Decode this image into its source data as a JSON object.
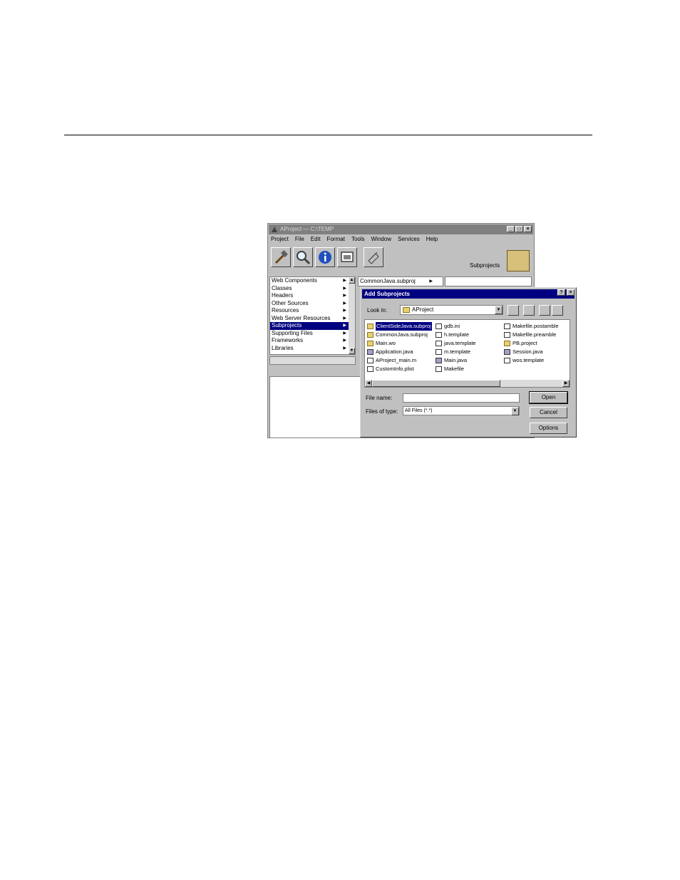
{
  "main_window": {
    "title": "AProject — C:\\TEMP",
    "menu": [
      "Project",
      "File",
      "Edit",
      "Format",
      "Tools",
      "Window",
      "Services",
      "Help"
    ],
    "subprojects_label": "Subprojects",
    "browser_left_items": [
      {
        "label": "Web Components",
        "arrow": true,
        "selected": false
      },
      {
        "label": "Classes",
        "arrow": true,
        "selected": false
      },
      {
        "label": "Headers",
        "arrow": true,
        "selected": false
      },
      {
        "label": "Other Sources",
        "arrow": true,
        "selected": false
      },
      {
        "label": "Resources",
        "arrow": true,
        "selected": false
      },
      {
        "label": "Web Server Resources",
        "arrow": true,
        "selected": false
      },
      {
        "label": "Subprojects",
        "arrow": true,
        "selected": true
      },
      {
        "label": "Supporting Files",
        "arrow": true,
        "selected": false
      },
      {
        "label": "Frameworks",
        "arrow": true,
        "selected": false
      },
      {
        "label": "Libraries",
        "arrow": true,
        "selected": false
      }
    ],
    "browser_mid_item": "CommonJava.subproj"
  },
  "dialog": {
    "title": "Add Subprojects",
    "look_in_label": "Look in:",
    "look_in_value": "AProject",
    "files_col1": [
      {
        "name": "ClientSideJava.subproj",
        "icon": "folder",
        "selected": true
      },
      {
        "name": "CommonJava.subproj",
        "icon": "folder",
        "selected": false
      },
      {
        "name": "Main.wo",
        "icon": "folder",
        "selected": false
      },
      {
        "name": "Application.java",
        "icon": "window",
        "selected": false
      },
      {
        "name": "AProject_main.m",
        "icon": "doc",
        "selected": false
      },
      {
        "name": "CustomInfo.plist",
        "icon": "doc",
        "selected": false
      }
    ],
    "files_col2": [
      {
        "name": "gdb.ini",
        "icon": "doc"
      },
      {
        "name": "h.template",
        "icon": "doc"
      },
      {
        "name": "java.template",
        "icon": "doc"
      },
      {
        "name": "m.template",
        "icon": "doc"
      },
      {
        "name": "Main.java",
        "icon": "window"
      },
      {
        "name": "Makefile",
        "icon": "doc"
      }
    ],
    "files_col3": [
      {
        "name": "Makefile.postamble",
        "icon": "doc"
      },
      {
        "name": "Makefile.preamble",
        "icon": "doc"
      },
      {
        "name": "PB.project",
        "icon": "folder"
      },
      {
        "name": "Session.java",
        "icon": "window"
      },
      {
        "name": "wos.template",
        "icon": "doc"
      }
    ],
    "file_name_label": "File name:",
    "file_name_value": "",
    "file_type_label": "Files of type:",
    "file_type_value": "All Files (*.*)",
    "open_label": "Open",
    "cancel_label": "Cancel",
    "options_label": "Options"
  }
}
